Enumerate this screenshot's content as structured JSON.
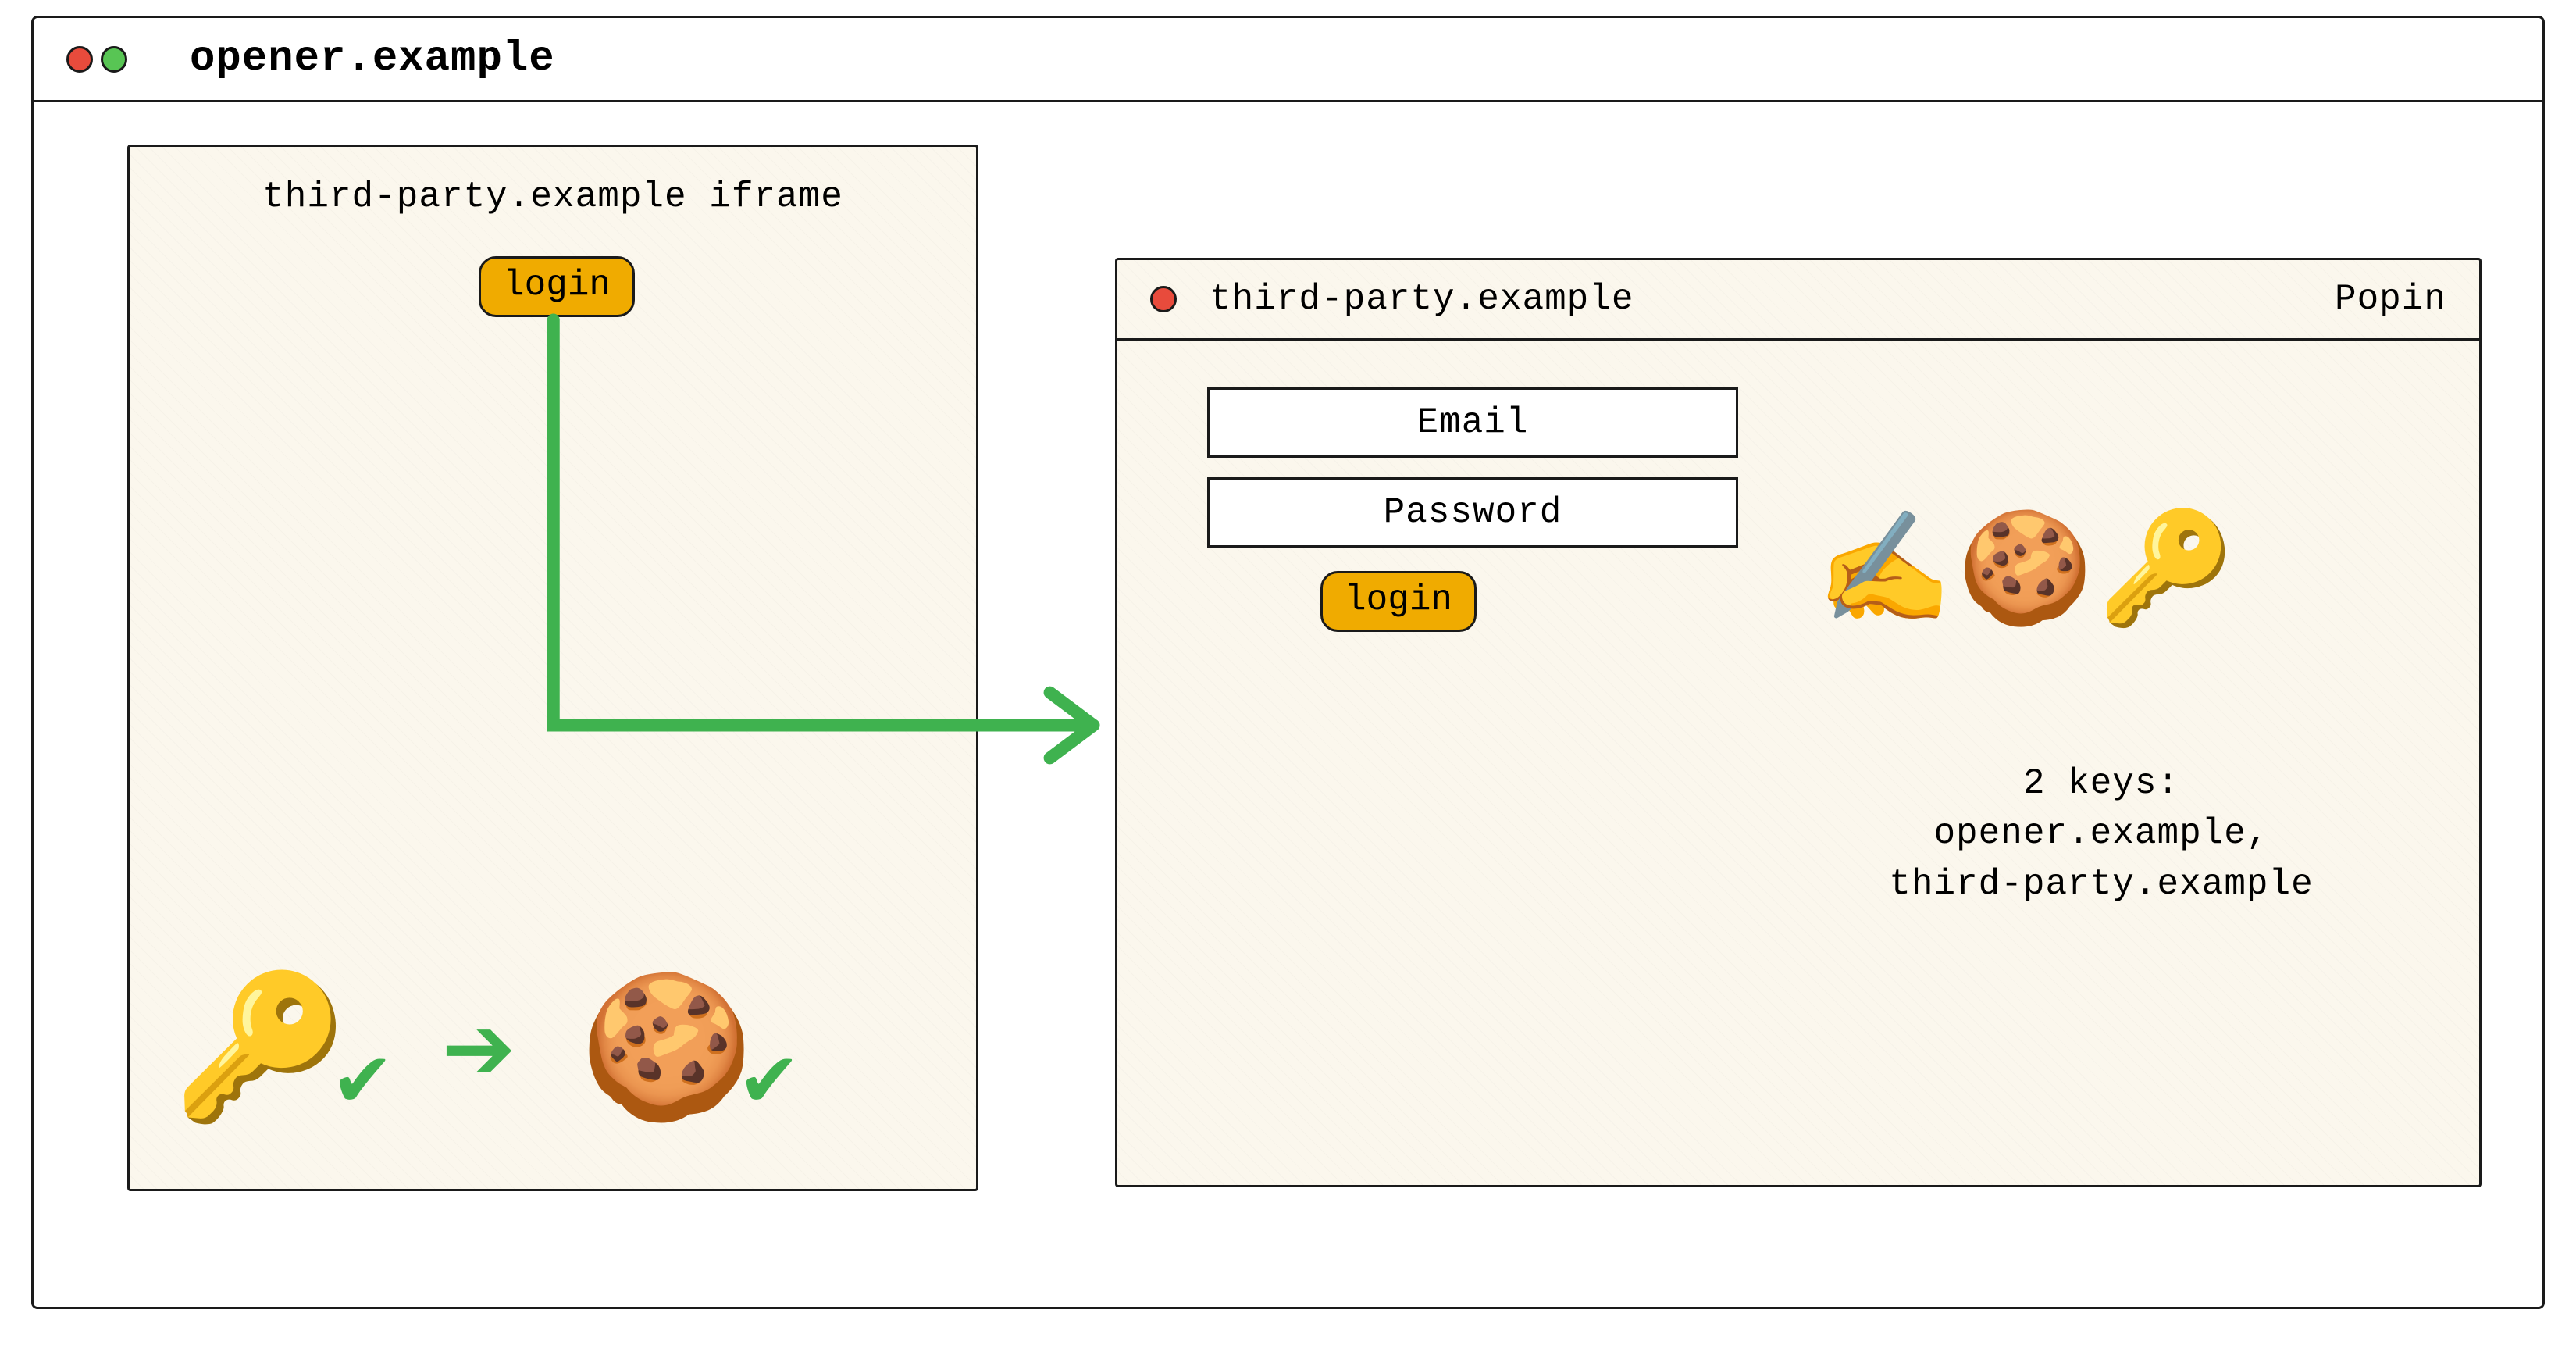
{
  "browser": {
    "title": "opener.example"
  },
  "iframe": {
    "label": "third-party.example iframe",
    "login_label": "login"
  },
  "popin": {
    "title": "third-party.example",
    "badge": "Popin",
    "email_placeholder": "Email",
    "password_placeholder": "Password",
    "login_label": "login",
    "keys_heading": "2 keys:",
    "keys_line_1": "opener.example,",
    "keys_line_2": "third-party.example"
  },
  "icons": {
    "writing_hand": "✍️",
    "cookie": "🍪",
    "key": "🔑",
    "check": "✔",
    "arrow_right": "➔"
  }
}
